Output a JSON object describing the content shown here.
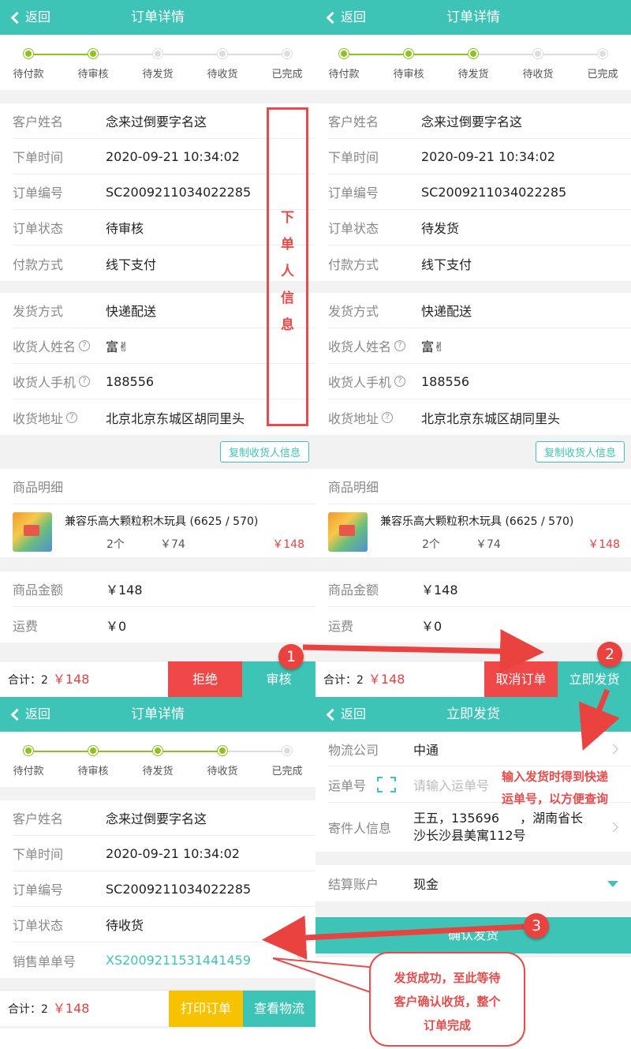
{
  "common": {
    "back": "返回",
    "header_title": "订单详情",
    "steps": [
      "待付款",
      "待审核",
      "待发货",
      "待收货",
      "已完成"
    ],
    "labels": {
      "customer": "客户姓名",
      "order_time": "下单时间",
      "order_no": "订单编号",
      "status": "订单状态",
      "pay_method": "付款方式",
      "ship_method": "发货方式",
      "receiver_name": "收货人姓名",
      "receiver_phone": "收货人手机",
      "receiver_addr": "收货地址",
      "sale_no": "销售单单号"
    },
    "values": {
      "customer": "念来过倒要字名这",
      "order_time": "2020-09-21 10:34:02",
      "order_no": "SC2009211034022285",
      "pay_method": "线下支付",
      "ship_method": "快递配送",
      "receiver_name": "富✌",
      "receiver_phone": "188556",
      "receiver_addr": "北京北京东城区胡同里头"
    },
    "copy_button": "复制收货人信息",
    "goods_title": "商品明细",
    "product": {
      "name": "兼容乐高大颗粒积木玩具 (6625 / 570)",
      "qty": "2个",
      "price": "￥74",
      "total": "￥148"
    },
    "goods_amount_label": "商品金额",
    "goods_amount": "￥148",
    "freight_label": "运费",
    "freight": "￥0",
    "sum_label": "合计：2",
    "sum_amount": "￥148"
  },
  "screen1": {
    "status": "待审核",
    "reject_button": "拒绝",
    "approve_button": "审核",
    "annotation": [
      "下",
      "单",
      "人",
      "信",
      "息"
    ]
  },
  "screen2": {
    "status": "待发货",
    "cancel_button": "取消订单",
    "ship_button": "立即发货"
  },
  "screen3": {
    "status": "待收货",
    "sale_no": "XS2009211531441459",
    "print_button": "打印订单",
    "logistics_button": "查看物流"
  },
  "screen4": {
    "header_title": "立即发货",
    "carrier_label": "物流公司",
    "carrier_value": "中通",
    "tracking_label": "运单号",
    "tracking_placeholder": "请输入运单号",
    "sender_label": "寄件人信息",
    "sender_value_1": "王五，135696",
    "sender_value_2": "，湖南省长",
    "sender_value_3": "沙长沙县美寓112号",
    "account_label": "结算账户",
    "account_value": "现金",
    "confirm_button": "确认发货"
  },
  "annotations": {
    "badge1": "1",
    "badge2": "2",
    "badge3": "3",
    "note_tracking_1": "输入发货时得到快递",
    "note_tracking_2": "运单号，以方便查询",
    "note_done_1": "发货成功，至此等待",
    "note_done_2": "客户确认收货，整个",
    "note_done_3": "订单完成"
  },
  "colors": {
    "teal": "#3ec4b6",
    "red": "#f04848",
    "yellow": "#f7c300",
    "green": "#8dc21f"
  }
}
